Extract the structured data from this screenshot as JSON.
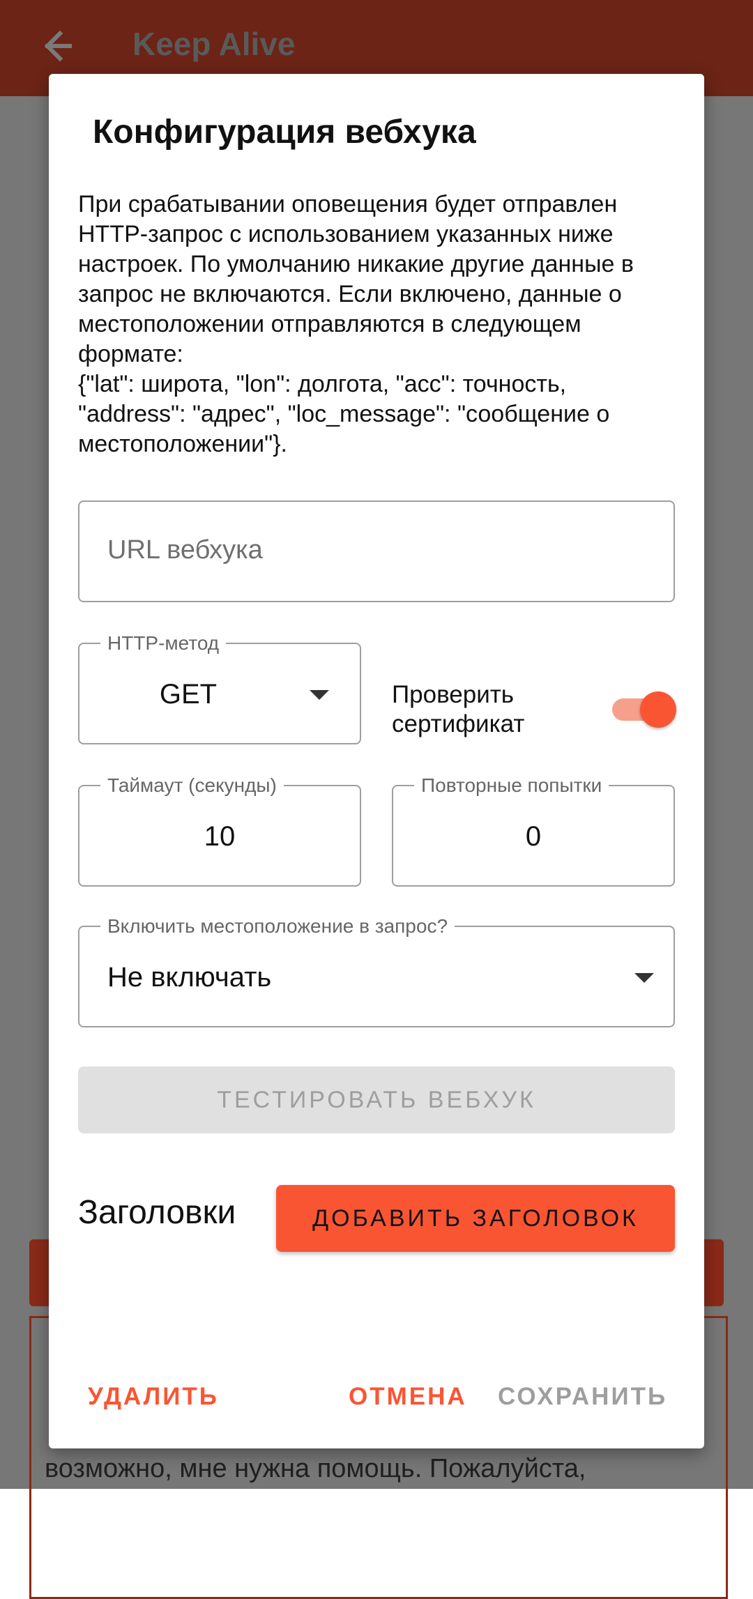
{
  "app": {
    "title": "Keep Alive",
    "bottom_text": "возможно, мне нужна помощь. Пожалуйста,"
  },
  "dialog": {
    "title": "Конфигурация вебхука",
    "description": [
      "При срабатывании оповещения будет отправлен HTTP-запрос с использованием указанных ниже настроек. По умолчанию никакие другие данные в запрос не включаются. Если включено, данные о местоположении отправляются в следующем формате:",
      "{\"lat\": широта, \"lon\": долгота, \"acc\": точность, \"address\": \"адрес\", \"loc_message\": \"сообщение о местоположении\"}."
    ],
    "url_field": {
      "placeholder": "URL вебхука",
      "value": ""
    },
    "http_method": {
      "label": "HTTP-метод",
      "value": "GET"
    },
    "verify_cert": {
      "label": "Проверить сертификат",
      "enabled": true
    },
    "timeout": {
      "label": "Таймаут (секунды)",
      "value": "10"
    },
    "retries": {
      "label": "Повторные попытки",
      "value": "0"
    },
    "include_location": {
      "label": "Включить местоположение в запрос?",
      "value": "Не включать"
    },
    "test_button": "ТЕСТИРОВАТЬ ВЕБХУК",
    "headers_label": "Заголовки",
    "add_header_button": "ДОБАВИТЬ ЗАГОЛОВОК",
    "actions": {
      "delete": "УДАЛИТЬ",
      "cancel": "ОТМЕНА",
      "save": "СОХРАНИТЬ"
    }
  },
  "colors": {
    "accent": "#fa5533",
    "appbar": "#6b2416",
    "disabled": "#9e9e9e"
  }
}
